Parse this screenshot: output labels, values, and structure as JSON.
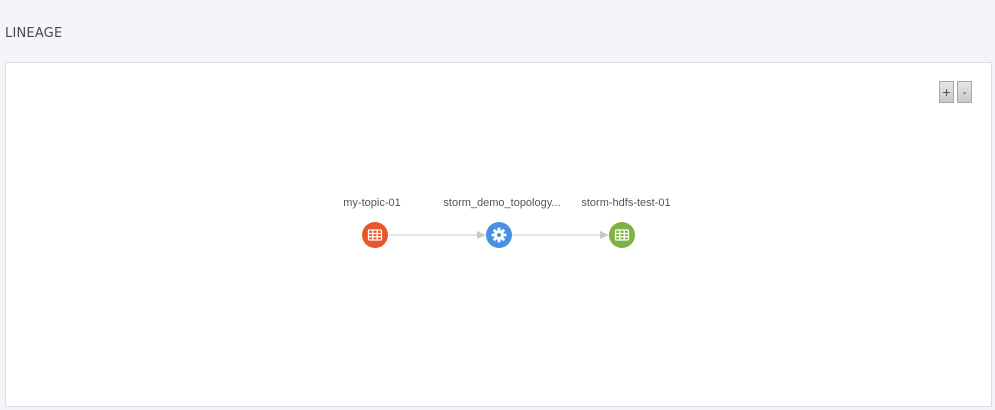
{
  "section": {
    "title": "LINEAGE"
  },
  "zoom": {
    "zoom_in_label": "+",
    "zoom_out_label": "-"
  },
  "lineage": {
    "nodes": [
      {
        "label": "my-topic-01",
        "icon": "table-icon",
        "color": "#e8562a"
      },
      {
        "label": "storm_demo_topology...",
        "icon": "gear-icon",
        "color": "#4a90e2"
      },
      {
        "label": "storm-hdfs-test-01",
        "icon": "table-icon",
        "color": "#7cb342"
      }
    ],
    "edge_color": "#c8c8c8"
  }
}
